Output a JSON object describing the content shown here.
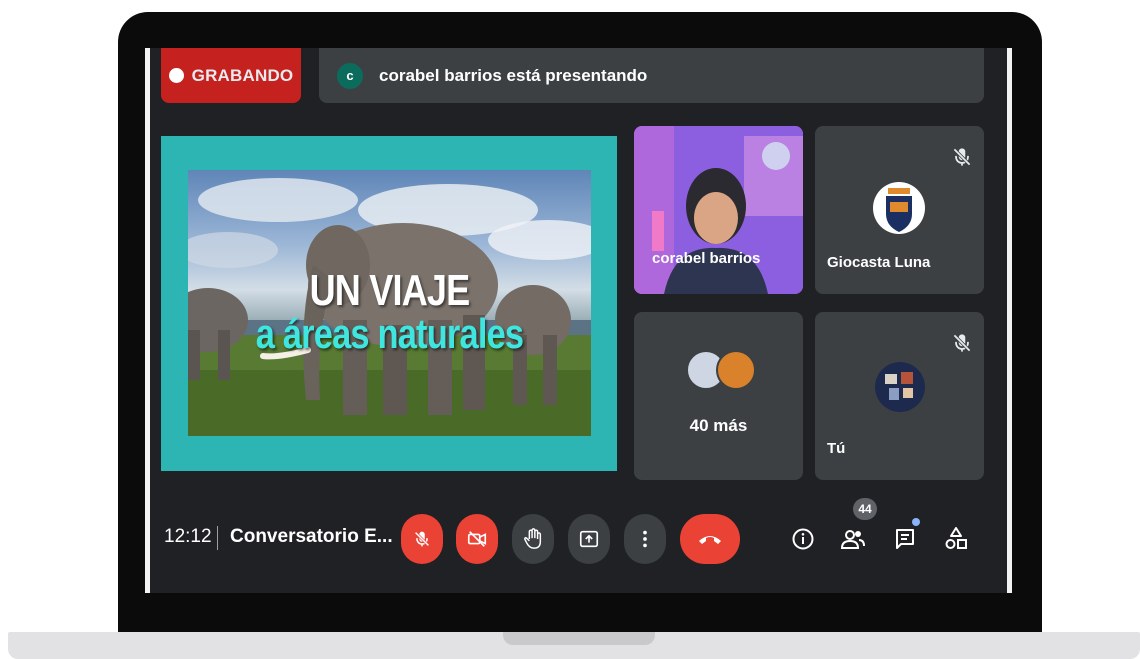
{
  "recording": {
    "label": "GRABANDO"
  },
  "presenter_bar": {
    "avatar_letter": "c",
    "text": "corabel barrios está presentando"
  },
  "slide": {
    "title_line1": "UN VIAJE",
    "title_line2": "a áreas naturales"
  },
  "participants": [
    {
      "name": "corabel barrios",
      "muted": false
    },
    {
      "name": "Giocasta Luna",
      "muted": true
    },
    {
      "name": "40 más"
    },
    {
      "name": "Tú",
      "muted": true
    }
  ],
  "footer": {
    "time": "12:12",
    "meeting_title": "Conversatorio E...",
    "participant_count": "44"
  },
  "colors": {
    "accent_red": "#ea4335",
    "recording_red": "#c5221f",
    "tile": "#3c4043",
    "slide_bg": "#2cb5b2",
    "slide_title": "#3fe6e0"
  },
  "icons": [
    "mic-off-icon",
    "camera-off-icon",
    "raise-hand-icon",
    "present-icon",
    "more-options-icon",
    "leave-call-icon",
    "info-icon",
    "people-icon",
    "chat-icon",
    "activities-icon"
  ]
}
